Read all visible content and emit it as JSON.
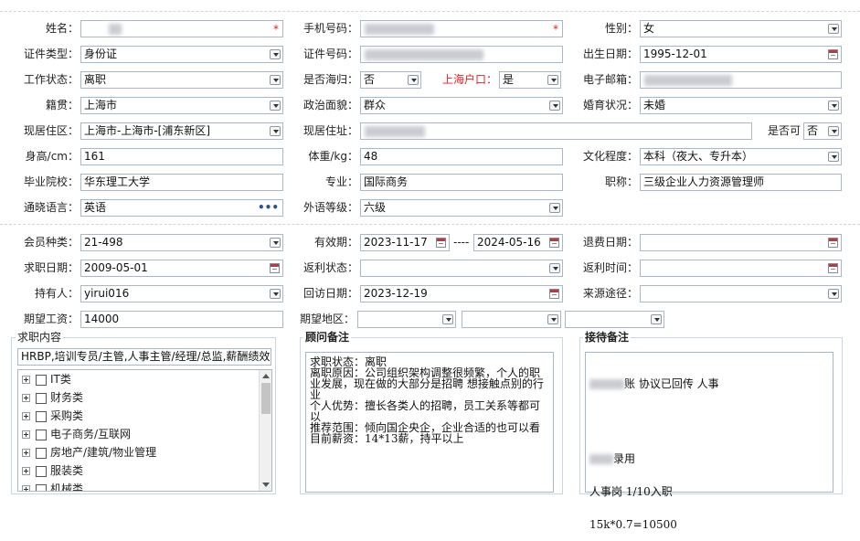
{
  "row1": {
    "name_label": "姓名：",
    "phone_label": "手机号码：",
    "gender_label": "性别：",
    "gender_value": "女"
  },
  "row2": {
    "id_type_label": "证件类型：",
    "id_type_value": "身份证",
    "id_no_label": "证件号码：",
    "birth_label": "出生日期：",
    "birth_value": "1995-12-01"
  },
  "row3": {
    "work_label": "工作状态：",
    "work_value": "离职",
    "abroad_label": "是否海归：",
    "abroad_value": "否",
    "hukou_label": "上海户口：",
    "hukou_value": "是",
    "email_label": "电子邮箱："
  },
  "row4": {
    "native_label": "籍贯：",
    "native_value": "上海市",
    "political_label": "政治面貌：",
    "political_value": "群众",
    "marital_label": "婚育状况：",
    "marital_value": "未婚"
  },
  "row5": {
    "residence_label": "现居住区：",
    "residence_value": "上海市-上海市-[浦东新区]",
    "address_label": "现居住址：",
    "ok_label": "是否可",
    "ok_value": "否"
  },
  "row6": {
    "height_label": "身高/cm：",
    "height_value": "161",
    "weight_label": "体重/kg：",
    "weight_value": "48",
    "edu_label": "文化程度：",
    "edu_value": "本科（夜大、专升本）"
  },
  "row7": {
    "school_label": "毕业院校：",
    "school_value": "华东理工大学",
    "major_label": "专业：",
    "major_value": "国际商务",
    "title_label": "职称：",
    "title_value": "三级企业人力资源管理师"
  },
  "row8": {
    "lang_label": "通晓语言：",
    "lang_value": "英语",
    "lang_more": "•••",
    "level_label": "外语等级：",
    "level_value": "六级"
  },
  "row9": {
    "member_label": "会员种类：",
    "member_value": "21-498",
    "valid_label": "有效期：",
    "valid_from": "2023-11-17",
    "valid_sep": "----",
    "valid_to": "2024-05-16",
    "refund_label": "退费日期："
  },
  "row10": {
    "job_date_label": "求职日期：",
    "job_date_value": "2009-05-01",
    "rebate_status_label": "返利状态：",
    "rebate_time_label": "返利时间："
  },
  "row11": {
    "holder_label": "持有人：",
    "holder_value": "yirui016",
    "visit_label": "回访日期：",
    "visit_value": "2023-12-19",
    "source_label": "来源途径："
  },
  "row12": {
    "salary_label": "期望工资：",
    "salary_value": "14000",
    "region_label": "期望地区："
  },
  "job_content": {
    "title": "求职内容",
    "summary": "HRBP,培训专员/主管,人事主管/经理/总监,薪酬绩效主",
    "tree": [
      "IT类",
      "财务类",
      "采购类",
      "电子商务/互联网",
      "房地产/建筑/物业管理",
      "服装类",
      "机械类"
    ]
  },
  "advisor_notes": {
    "title": "顾问备注",
    "text": "求职状态：离职\n离职原因：公司组织架构调整很频繁，个人的职业发展，现在做的大部分是招聘 想接触点别的行业\n个人优势：擅长各类人的招聘，员工关系等都可以\n推荐范围：倾向国企央企，企业合适的也可以看\n目前薪资：14*13薪，持平以上"
  },
  "reception_notes": {
    "title": "接待备注",
    "line1": "账 协议已回传 人事",
    "line2": "录用",
    "line3": "人事岗 1/10入职",
    "line4": "15k*0.7=10500"
  }
}
